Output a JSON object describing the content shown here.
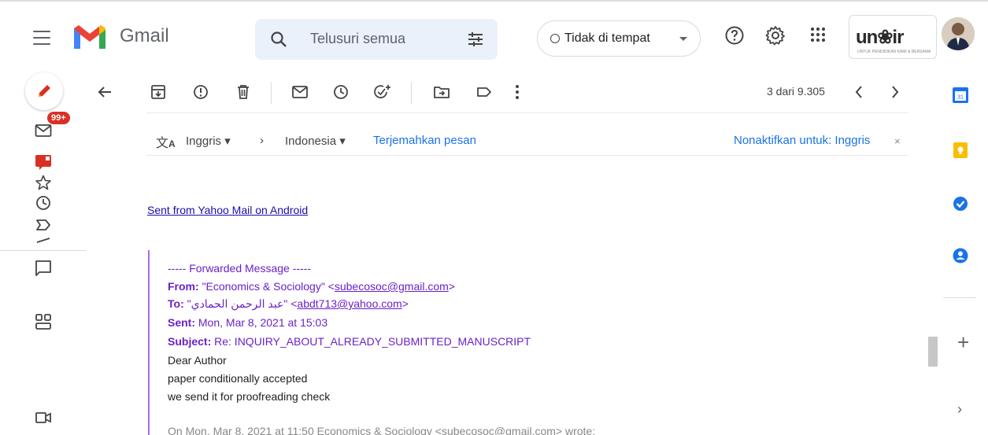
{
  "header": {
    "app_name": "Gmail",
    "search_placeholder": "Telusuri semua",
    "status_label": "Tidak di tempat",
    "org_logo_text": "un❀ir",
    "org_logo_subtext": "UNTUK PENDIDIKAN KAMI & BERSAMA"
  },
  "sidebar": {
    "inbox_badge": "99+"
  },
  "toolbar": {
    "pager": "3 dari 9.305"
  },
  "translate": {
    "from_lang": "Inggris",
    "to_lang": "Indonesia",
    "translate_link": "Terjemahkan pesan",
    "disable_link": "Nonaktifkan untuk: Inggris",
    "close_glyph": "×"
  },
  "message": {
    "sent_from": "Sent from Yahoo Mail on Android",
    "forward_header": "----- Forwarded Message -----",
    "from_label": "From:",
    "from_name": "\"Economics & Sociology\" <",
    "from_email": "subecosoc@gmail.com",
    "from_close": ">",
    "to_label": "To:",
    "to_name": "\"عبد الرحمن الحمادي\" <",
    "to_email": "abdt713@yahoo.com",
    "to_close": ">",
    "sent_label": "Sent:",
    "sent_value": "Mon, Mar 8, 2021 at 15:03",
    "subject_label": "Subject:",
    "subject_value": "Re: INQUIRY_ABOUT_ALREADY_SUBMITTED_MANUSCRIPT",
    "body_line1": "Dear Author",
    "body_line2": "paper conditionally accepted",
    "body_line3": "we send it for proofreading check",
    "cut_line": "On Mon, Mar 8, 2021 at 11:50 Economics & Sociology <subecosoc@gmail.com> wrote:"
  },
  "right_rail": {
    "plus": "+",
    "chevron": "›"
  }
}
